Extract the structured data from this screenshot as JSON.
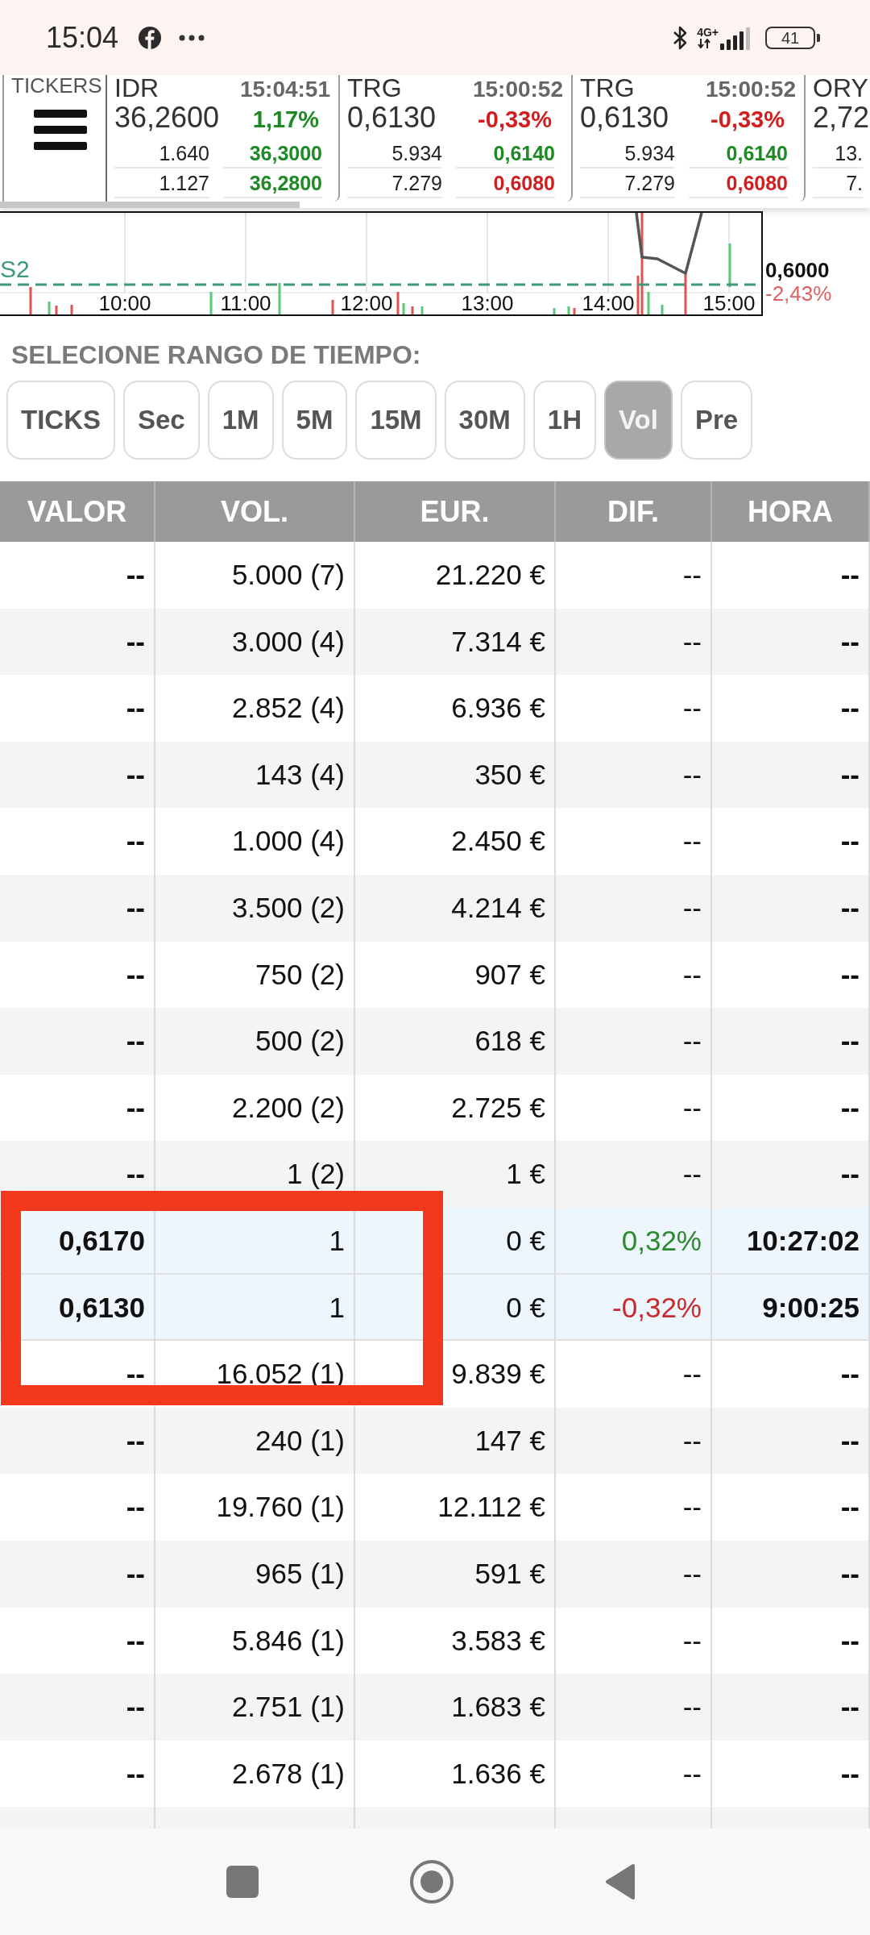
{
  "status_bar": {
    "time": "15:04",
    "network": "4G+",
    "battery": "41"
  },
  "tickers": {
    "label": "TICKERS",
    "items": [
      {
        "symbol": "IDR",
        "time": "15:04:51",
        "price": "36,2600",
        "change": "1,17%",
        "color": "#1d8a25",
        "book": [
          {
            "qty": "1.640",
            "price": "36,3000",
            "color": "#1d8a25"
          },
          {
            "qty": "1.127",
            "price": "36,2800",
            "color": "#1d8a25"
          }
        ]
      },
      {
        "symbol": "TRG",
        "time": "15:00:52",
        "price": "0,6130",
        "change": "-0,33%",
        "color": "#d01f1f",
        "book": [
          {
            "qty": "5.934",
            "price": "0,6140",
            "color": "#1d8a25"
          },
          {
            "qty": "7.279",
            "price": "0,6080",
            "color": "#d01f1f"
          }
        ]
      },
      {
        "symbol": "TRG",
        "time": "15:00:52",
        "price": "0,6130",
        "change": "-0,33%",
        "color": "#d01f1f",
        "book": [
          {
            "qty": "5.934",
            "price": "0,6140",
            "color": "#1d8a25"
          },
          {
            "qty": "7.279",
            "price": "0,6080",
            "color": "#d01f1f"
          }
        ]
      },
      {
        "symbol": "ORY",
        "price": "2,72",
        "book": [
          {
            "qty": "13."
          },
          {
            "qty": "7."
          }
        ]
      }
    ]
  },
  "chart": {
    "support_label": "S2",
    "price": "0,6000",
    "change": "-2,43%",
    "time_labels": [
      "10:00",
      "11:00",
      "12:00",
      "13:00",
      "14:00",
      "15:00"
    ]
  },
  "time_range": {
    "title": "SELECIONE RANGO DE TIEMPO:",
    "options": [
      {
        "label": "TICKS",
        "selected": false
      },
      {
        "label": "Sec",
        "selected": false
      },
      {
        "label": "1M",
        "selected": false
      },
      {
        "label": "5M",
        "selected": false
      },
      {
        "label": "15M",
        "selected": false
      },
      {
        "label": "30M",
        "selected": false
      },
      {
        "label": "1H",
        "selected": false
      },
      {
        "label": "Vol",
        "selected": true
      },
      {
        "label": "Pre",
        "selected": false
      }
    ]
  },
  "table": {
    "columns": [
      "VALOR",
      "VOL.",
      "EUR.",
      "DIF.",
      "HORA"
    ],
    "rows": [
      {
        "valor": "--",
        "vol": "5.000 (7)",
        "eur": "21.220 €",
        "dif": "--",
        "hora": "--",
        "highlighted": false,
        "color": "#111111"
      },
      {
        "valor": "--",
        "vol": "3.000 (4)",
        "eur": "7.314 €",
        "dif": "--",
        "hora": "--",
        "highlighted": false,
        "color": "#111111"
      },
      {
        "valor": "--",
        "vol": "2.852 (4)",
        "eur": "6.936 €",
        "dif": "--",
        "hora": "--",
        "highlighted": false,
        "color": "#111111"
      },
      {
        "valor": "--",
        "vol": "143 (4)",
        "eur": "350 €",
        "dif": "--",
        "hora": "--",
        "highlighted": false,
        "color": "#111111"
      },
      {
        "valor": "--",
        "vol": "1.000 (4)",
        "eur": "2.450 €",
        "dif": "--",
        "hora": "--",
        "highlighted": false,
        "color": "#111111"
      },
      {
        "valor": "--",
        "vol": "3.500 (2)",
        "eur": "4.214 €",
        "dif": "--",
        "hora": "--",
        "highlighted": false,
        "color": "#111111"
      },
      {
        "valor": "--",
        "vol": "750 (2)",
        "eur": "907 €",
        "dif": "--",
        "hora": "--",
        "highlighted": false,
        "color": "#111111"
      },
      {
        "valor": "--",
        "vol": "500 (2)",
        "eur": "618 €",
        "dif": "--",
        "hora": "--",
        "highlighted": false,
        "color": "#111111"
      },
      {
        "valor": "--",
        "vol": "2.200 (2)",
        "eur": "2.725 €",
        "dif": "--",
        "hora": "--",
        "highlighted": false,
        "color": "#111111"
      },
      {
        "valor": "--",
        "vol": "1 (2)",
        "eur": "1 €",
        "dif": "--",
        "hora": "--",
        "highlighted": false,
        "color": "#111111"
      },
      {
        "valor": "0,6170",
        "vol": "1",
        "eur": "0 €",
        "dif": "0,32%",
        "hora": "10:27:02",
        "highlighted": true,
        "color": "#2b8a2b"
      },
      {
        "valor": "0,6130",
        "vol": "1",
        "eur": "0 €",
        "dif": "-0,32%",
        "hora": "9:00:25",
        "highlighted": true,
        "color": "#c92a2a"
      },
      {
        "valor": "--",
        "vol": "16.052 (1)",
        "eur": "9.839 €",
        "dif": "--",
        "hora": "--",
        "highlighted": false,
        "color": "#111111"
      },
      {
        "valor": "--",
        "vol": "240 (1)",
        "eur": "147 €",
        "dif": "--",
        "hora": "--",
        "highlighted": false,
        "color": "#111111"
      },
      {
        "valor": "--",
        "vol": "19.760 (1)",
        "eur": "12.112 €",
        "dif": "--",
        "hora": "--",
        "highlighted": false,
        "color": "#111111"
      },
      {
        "valor": "--",
        "vol": "965 (1)",
        "eur": "591 €",
        "dif": "--",
        "hora": "--",
        "highlighted": false,
        "color": "#111111"
      },
      {
        "valor": "--",
        "vol": "5.846 (1)",
        "eur": "3.583 €",
        "dif": "--",
        "hora": "--",
        "highlighted": false,
        "color": "#111111"
      },
      {
        "valor": "--",
        "vol": "2.751 (1)",
        "eur": "1.683 €",
        "dif": "--",
        "hora": "--",
        "highlighted": false,
        "color": "#111111"
      },
      {
        "valor": "--",
        "vol": "2.678 (1)",
        "eur": "1.636 €",
        "dif": "--",
        "hora": "--",
        "highlighted": false,
        "color": "#111111"
      }
    ]
  },
  "annotations": [
    {
      "kind": "rectangle"
    }
  ]
}
